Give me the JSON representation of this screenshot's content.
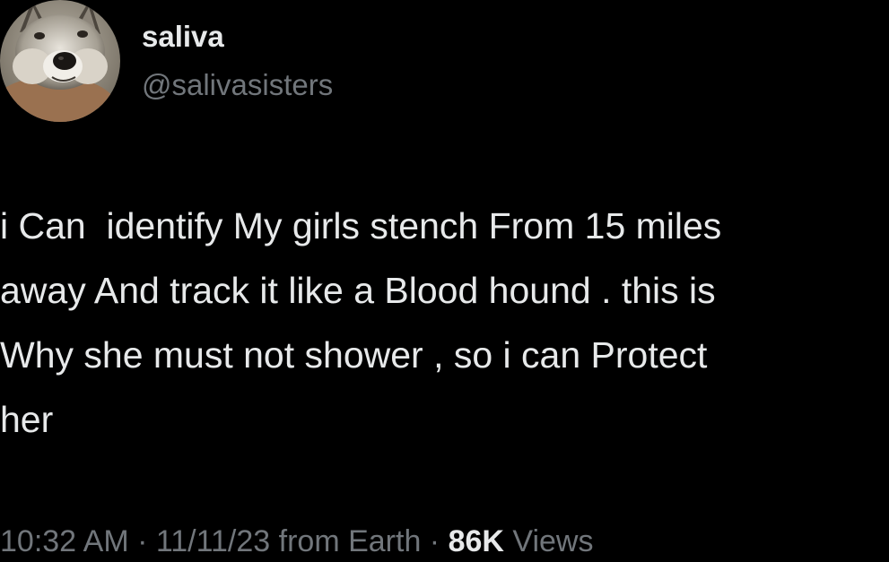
{
  "tweet": {
    "author": {
      "display_name": "saliva",
      "handle": "@salivasisters",
      "avatar_icon": "wolf-avatar-icon"
    },
    "text_lines": [
      "i Can  identify My girls stench From 15 miles",
      "away And track it like a Blood hound . this is",
      "Why she must not shower , so i can Protect",
      "her"
    ],
    "meta": {
      "time": "10:32 AM",
      "separator": " · ",
      "date": "11/11/23",
      "source": "from Earth",
      "views_count": "86K",
      "views_label": "Views"
    }
  },
  "colors": {
    "background": "#000000",
    "primary_text": "#e7e9ea",
    "secondary_text": "#71767b"
  }
}
